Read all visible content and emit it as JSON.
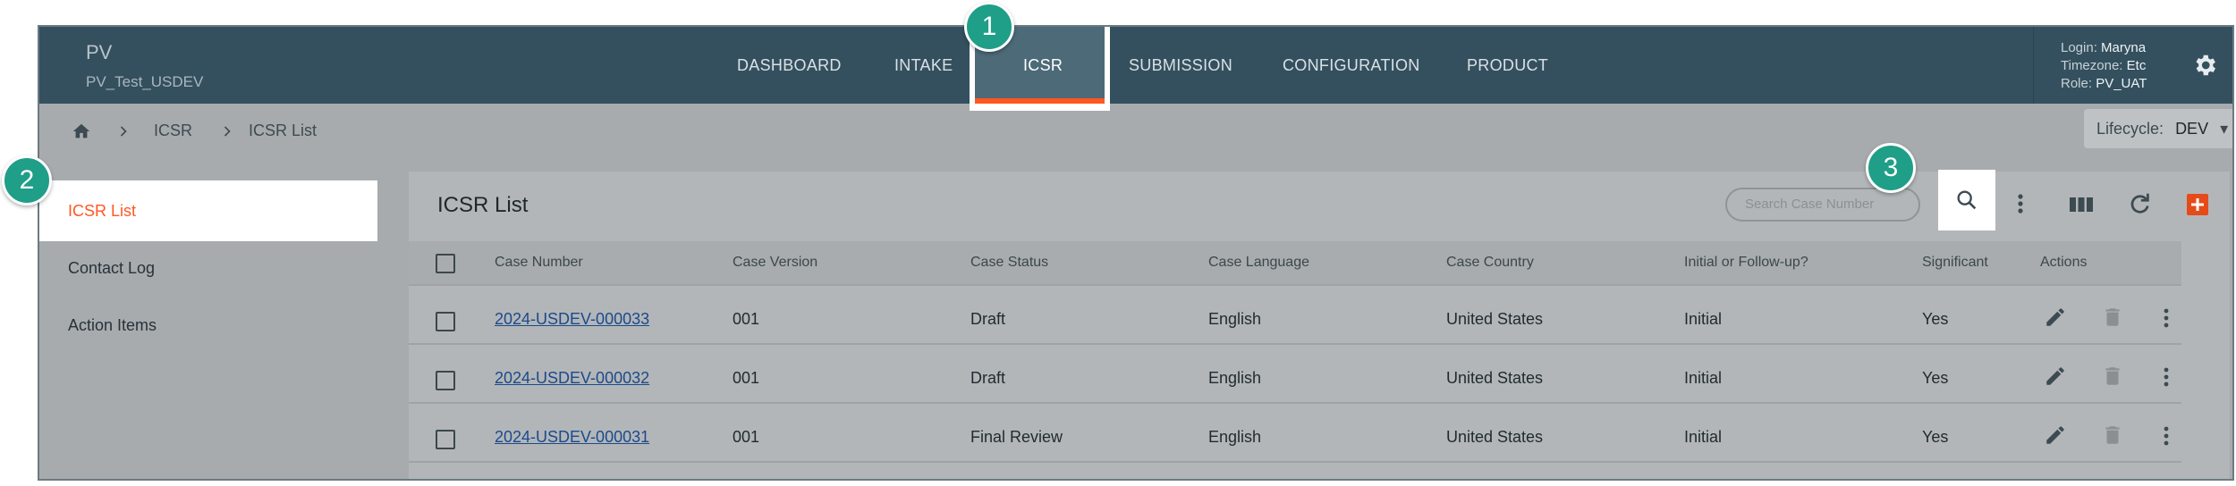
{
  "header": {
    "app_name": "PV",
    "env_name": "PV_Test_USDEV",
    "nav": [
      "DASHBOARD",
      "INTAKE",
      "ICSR",
      "SUBMISSION",
      "CONFIGURATION",
      "PRODUCT"
    ],
    "active_nav": "ICSR",
    "user": {
      "login_label": "Login:",
      "login_value": "Maryna",
      "timezone_label": "Timezone:",
      "timezone_value": "Etc",
      "role_label": "Role:",
      "role_value": "PV_UAT"
    },
    "gear_icon": "gear-icon"
  },
  "breadcrumb": {
    "home_icon": "home-icon",
    "items": [
      "ICSR",
      "ICSR List"
    ]
  },
  "lifecycle": {
    "label": "Lifecycle:",
    "value": "DEV"
  },
  "sidebar": {
    "items": [
      {
        "label": "ICSR List",
        "active": true
      },
      {
        "label": "Contact Log",
        "active": false
      },
      {
        "label": "Action Items",
        "active": false
      }
    ]
  },
  "panel": {
    "title": "ICSR List",
    "search_placeholder": "Search Case Number",
    "toolbar_icons": [
      "search-icon",
      "more-vert-icon",
      "columns-icon",
      "refresh-icon",
      "add-icon"
    ],
    "add_color": "#e64a19"
  },
  "table": {
    "headers": [
      "Case Number",
      "Case Version",
      "Case Status",
      "Case Language",
      "Case Country",
      "Initial or Follow-up?",
      "Significant",
      "Actions"
    ],
    "rows": [
      [
        "2024-USDEV-000033",
        "001",
        "Draft",
        "English",
        "United States",
        "Initial",
        "Yes"
      ],
      [
        "2024-USDEV-000032",
        "001",
        "Draft",
        "English",
        "United States",
        "Initial",
        "Yes"
      ],
      [
        "2024-USDEV-000031",
        "001",
        "Final Review",
        "English",
        "United States",
        "Initial",
        "Yes"
      ]
    ]
  },
  "callouts": [
    "1",
    "2",
    "3"
  ],
  "colors": {
    "header": "#34505f",
    "accent": "#ff5722",
    "callout": "#1f9e88"
  }
}
